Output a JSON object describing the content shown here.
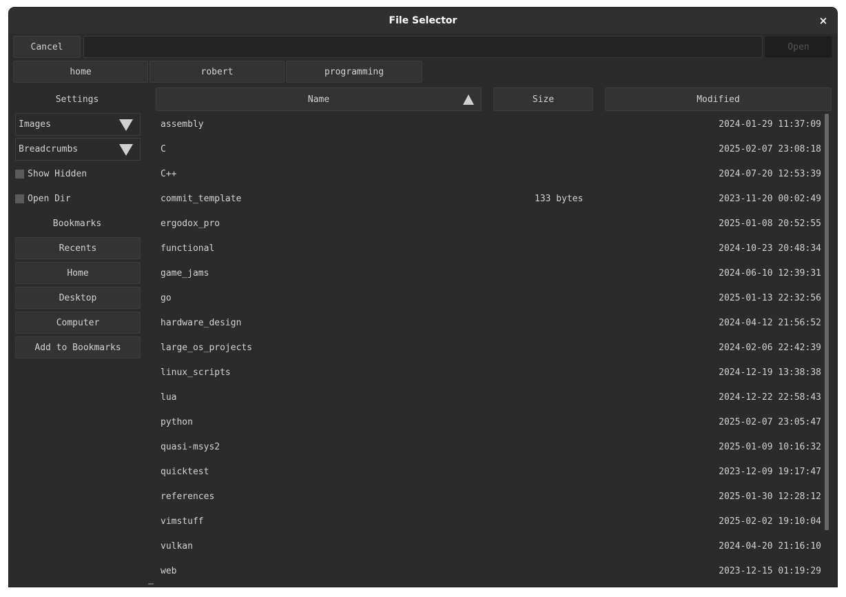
{
  "window": {
    "title": "File Selector",
    "close_glyph": "×"
  },
  "toolbar": {
    "cancel_label": "Cancel",
    "path_value": "",
    "open_label": "Open"
  },
  "breadcrumbs": [
    "home",
    "robert",
    "programming"
  ],
  "sidebar": {
    "settings_heading": "Settings",
    "view_mode": "Images",
    "path_mode": "Breadcrumbs",
    "show_hidden_label": "Show Hidden",
    "show_hidden_checked": false,
    "open_dir_label": "Open Dir",
    "open_dir_checked": false,
    "bookmarks_heading": "Bookmarks",
    "bookmarks": [
      "Recents",
      "Home",
      "Desktop",
      "Computer"
    ],
    "add_bookmark_label": "Add to Bookmarks"
  },
  "columns": {
    "name": "Name",
    "size": "Size",
    "modified": "Modified",
    "sort_icon": "sort-ascending-icon"
  },
  "files": [
    {
      "name": "assembly",
      "size": "",
      "modified": "2024-01-29 11:37:09"
    },
    {
      "name": "C",
      "size": "",
      "modified": "2025-02-07 23:08:18"
    },
    {
      "name": "C++",
      "size": "",
      "modified": "2024-07-20 12:53:39"
    },
    {
      "name": "commit_template",
      "size": "133 bytes",
      "modified": "2023-11-20 00:02:49"
    },
    {
      "name": "ergodox_pro",
      "size": "",
      "modified": "2025-01-08 20:52:55"
    },
    {
      "name": "functional",
      "size": "",
      "modified": "2024-10-23 20:48:34"
    },
    {
      "name": "game_jams",
      "size": "",
      "modified": "2024-06-10 12:39:31"
    },
    {
      "name": "go",
      "size": "",
      "modified": "2025-01-13 22:32:56"
    },
    {
      "name": "hardware_design",
      "size": "",
      "modified": "2024-04-12 21:56:52"
    },
    {
      "name": "large_os_projects",
      "size": "",
      "modified": "2024-02-06 22:42:39"
    },
    {
      "name": "linux_scripts",
      "size": "",
      "modified": "2024-12-19 13:38:38"
    },
    {
      "name": "lua",
      "size": "",
      "modified": "2024-12-22 22:58:43"
    },
    {
      "name": "python",
      "size": "",
      "modified": "2025-02-07 23:05:47"
    },
    {
      "name": "quasi-msys2",
      "size": "",
      "modified": "2025-01-09 10:16:32"
    },
    {
      "name": "quicktest",
      "size": "",
      "modified": "2023-12-09 19:17:47"
    },
    {
      "name": "references",
      "size": "",
      "modified": "2025-01-30 12:28:12"
    },
    {
      "name": "vimstuff",
      "size": "",
      "modified": "2025-02-02 19:10:04"
    },
    {
      "name": "vulkan",
      "size": "",
      "modified": "2024-04-20 21:16:10"
    },
    {
      "name": "web",
      "size": "",
      "modified": "2023-12-15 01:19:29"
    }
  ],
  "colors": {
    "window_bg": "#2b2b2b",
    "button_bg": "#333333",
    "text": "#d2d2d2",
    "scrollbar": "#6a6a6a"
  }
}
